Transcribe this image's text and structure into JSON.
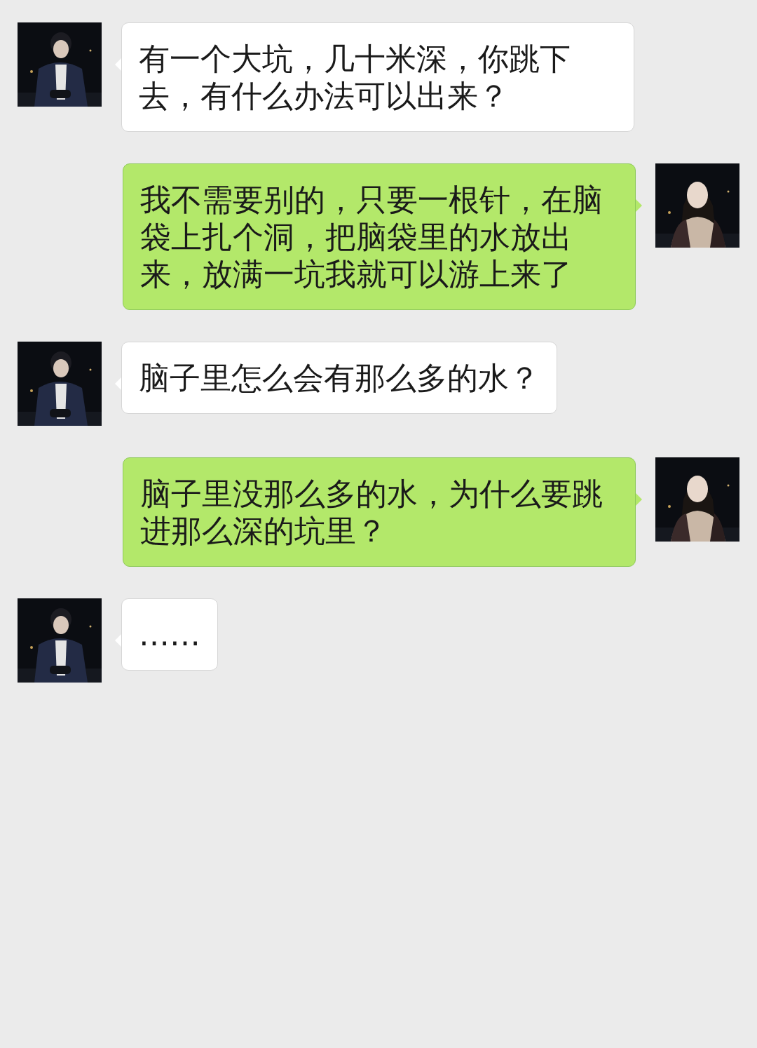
{
  "messages": [
    {
      "kind": "received",
      "text": "有一个大坑，几十米深，你跳下去，有什么办法可以出来？"
    },
    {
      "kind": "sent",
      "text": "我不需要别的，只要一根针，在脑袋上扎个洞，把脑袋里的水放出来，放满一坑我就可以游上来了"
    },
    {
      "kind": "received",
      "text": "脑子里怎么会有那么多的水？"
    },
    {
      "kind": "sent",
      "text": "脑子里没那么多的水，为什么要跳进那么深的坑里？"
    },
    {
      "kind": "received",
      "text": "……"
    }
  ]
}
